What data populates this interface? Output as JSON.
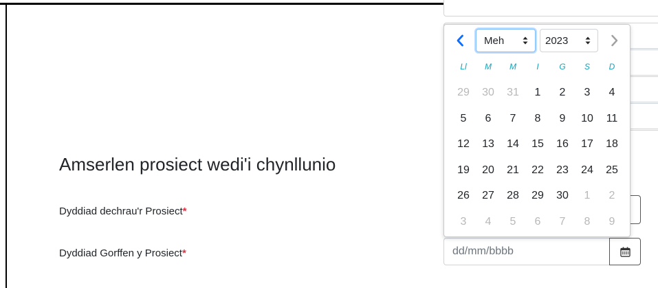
{
  "clipped_top_text": "",
  "background_input_values": {
    "top_partial": "dd/mm/bbbb"
  },
  "section": {
    "title": "Amserlen prosiect wedi'i chynllunio"
  },
  "fields": [
    {
      "label": "Dyddiad dechrau'r Prosiect",
      "required_mark": "*"
    },
    {
      "label": "Dyddiad Gorffen y Prosiect",
      "required_mark": "*",
      "placeholder": "dd/mm/bbbb"
    }
  ],
  "datepicker": {
    "month_selected": "Meh",
    "year_selected": "2023",
    "weekdays": [
      "Ll",
      "M",
      "M",
      "I",
      "G",
      "S",
      "D"
    ],
    "weeks": [
      [
        {
          "d": "29",
          "muted": true
        },
        {
          "d": "30",
          "muted": true
        },
        {
          "d": "31",
          "muted": true
        },
        {
          "d": "1"
        },
        {
          "d": "2"
        },
        {
          "d": "3"
        },
        {
          "d": "4"
        }
      ],
      [
        {
          "d": "5"
        },
        {
          "d": "6"
        },
        {
          "d": "7"
        },
        {
          "d": "8"
        },
        {
          "d": "9"
        },
        {
          "d": "10"
        },
        {
          "d": "11"
        }
      ],
      [
        {
          "d": "12"
        },
        {
          "d": "13"
        },
        {
          "d": "14"
        },
        {
          "d": "15"
        },
        {
          "d": "16"
        },
        {
          "d": "17"
        },
        {
          "d": "18"
        }
      ],
      [
        {
          "d": "19"
        },
        {
          "d": "20"
        },
        {
          "d": "21"
        },
        {
          "d": "22"
        },
        {
          "d": "23"
        },
        {
          "d": "24"
        },
        {
          "d": "25"
        }
      ],
      [
        {
          "d": "26"
        },
        {
          "d": "27"
        },
        {
          "d": "28"
        },
        {
          "d": "29"
        },
        {
          "d": "30"
        },
        {
          "d": "1",
          "muted": true
        },
        {
          "d": "2",
          "muted": true
        }
      ],
      [
        {
          "d": "3",
          "muted": true
        },
        {
          "d": "4",
          "muted": true
        },
        {
          "d": "5",
          "muted": true
        },
        {
          "d": "6",
          "muted": true
        },
        {
          "d": "7",
          "muted": true
        },
        {
          "d": "8",
          "muted": true
        },
        {
          "d": "9",
          "muted": true
        }
      ]
    ]
  },
  "colors": {
    "accent": "#0d6efd",
    "required": "#dc3545",
    "weekday": "#17a2b8"
  },
  "icons": {
    "prev": "chevron-left-icon",
    "next": "chevron-right-icon",
    "calendar": "calendar-icon"
  }
}
